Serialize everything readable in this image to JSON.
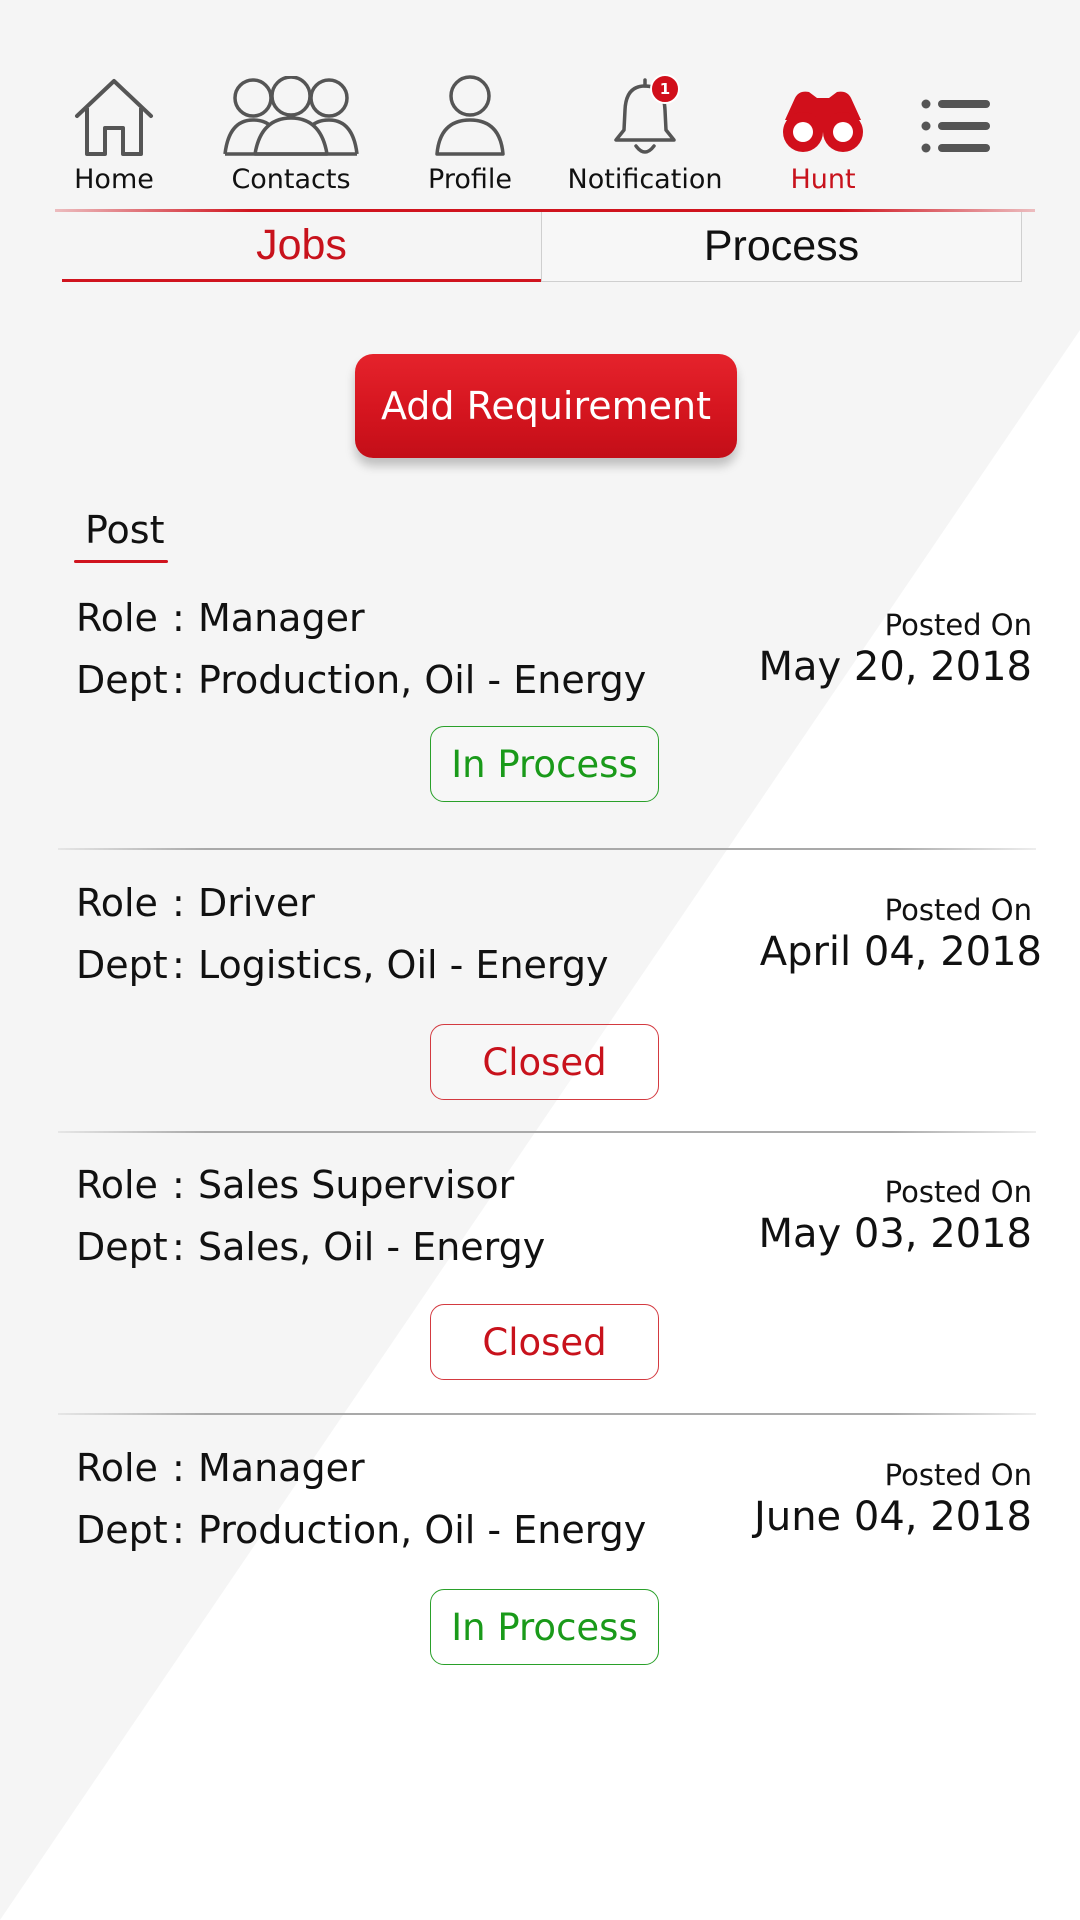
{
  "nav": {
    "items": [
      {
        "label": "Home",
        "icon": "home-icon"
      },
      {
        "label": "Contacts",
        "icon": "contacts-icon"
      },
      {
        "label": "Profile",
        "icon": "profile-icon"
      },
      {
        "label": "Notification",
        "icon": "bell-icon",
        "badge": "1"
      },
      {
        "label": "Hunt",
        "icon": "binoculars-icon",
        "active": true
      }
    ],
    "menu_icon": "menu-icon"
  },
  "tabs": [
    {
      "label": "Jobs",
      "active": true
    },
    {
      "label": "Process",
      "active": false
    }
  ],
  "add_requirement_label": "Add Requirement",
  "section_title": "Post",
  "role_label": "Role",
  "dept_label": "Dept",
  "separator": ":",
  "jobs": [
    {
      "role": "Manager",
      "dept": "Production, Oil - Energy",
      "posted_label": "Posted On",
      "date": "May 20, 2018",
      "status": "In Process",
      "status_type": "in-process"
    },
    {
      "role": "Driver",
      "dept": "Logistics, Oil - Energy",
      "posted_label": "Posted On",
      "date": "April 04, 2018",
      "status": "Closed",
      "status_type": "closed"
    },
    {
      "role": "Sales Supervisor",
      "dept": "Sales, Oil - Energy",
      "posted_label": "Posted On",
      "date": "May 03, 2018",
      "status": "Closed",
      "status_type": "closed"
    },
    {
      "role": "Manager",
      "dept": "Production, Oil - Energy",
      "posted_label": "Posted On",
      "date": "June 04, 2018",
      "status": "In Process",
      "status_type": "in-process"
    }
  ],
  "colors": {
    "accent": "#d0141e",
    "status_green": "#1a9a1a",
    "status_red": "#c8121c",
    "background": "#f5f5f5"
  }
}
